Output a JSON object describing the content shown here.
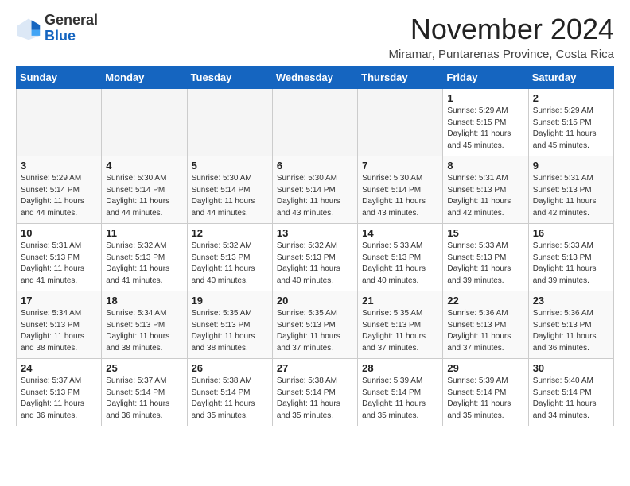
{
  "header": {
    "logo_general": "General",
    "logo_blue": "Blue",
    "month": "November 2024",
    "location": "Miramar, Puntarenas Province, Costa Rica"
  },
  "days_header": [
    "Sunday",
    "Monday",
    "Tuesday",
    "Wednesday",
    "Thursday",
    "Friday",
    "Saturday"
  ],
  "weeks": [
    [
      {
        "day": "",
        "empty": true
      },
      {
        "day": "",
        "empty": true
      },
      {
        "day": "",
        "empty": true
      },
      {
        "day": "",
        "empty": true
      },
      {
        "day": "",
        "empty": true
      },
      {
        "day": "1",
        "info": "Sunrise: 5:29 AM\nSunset: 5:15 PM\nDaylight: 11 hours\nand 45 minutes."
      },
      {
        "day": "2",
        "info": "Sunrise: 5:29 AM\nSunset: 5:15 PM\nDaylight: 11 hours\nand 45 minutes."
      }
    ],
    [
      {
        "day": "3",
        "info": "Sunrise: 5:29 AM\nSunset: 5:14 PM\nDaylight: 11 hours\nand 44 minutes."
      },
      {
        "day": "4",
        "info": "Sunrise: 5:30 AM\nSunset: 5:14 PM\nDaylight: 11 hours\nand 44 minutes."
      },
      {
        "day": "5",
        "info": "Sunrise: 5:30 AM\nSunset: 5:14 PM\nDaylight: 11 hours\nand 44 minutes."
      },
      {
        "day": "6",
        "info": "Sunrise: 5:30 AM\nSunset: 5:14 PM\nDaylight: 11 hours\nand 43 minutes."
      },
      {
        "day": "7",
        "info": "Sunrise: 5:30 AM\nSunset: 5:14 PM\nDaylight: 11 hours\nand 43 minutes."
      },
      {
        "day": "8",
        "info": "Sunrise: 5:31 AM\nSunset: 5:13 PM\nDaylight: 11 hours\nand 42 minutes."
      },
      {
        "day": "9",
        "info": "Sunrise: 5:31 AM\nSunset: 5:13 PM\nDaylight: 11 hours\nand 42 minutes."
      }
    ],
    [
      {
        "day": "10",
        "info": "Sunrise: 5:31 AM\nSunset: 5:13 PM\nDaylight: 11 hours\nand 41 minutes."
      },
      {
        "day": "11",
        "info": "Sunrise: 5:32 AM\nSunset: 5:13 PM\nDaylight: 11 hours\nand 41 minutes."
      },
      {
        "day": "12",
        "info": "Sunrise: 5:32 AM\nSunset: 5:13 PM\nDaylight: 11 hours\nand 40 minutes."
      },
      {
        "day": "13",
        "info": "Sunrise: 5:32 AM\nSunset: 5:13 PM\nDaylight: 11 hours\nand 40 minutes."
      },
      {
        "day": "14",
        "info": "Sunrise: 5:33 AM\nSunset: 5:13 PM\nDaylight: 11 hours\nand 40 minutes."
      },
      {
        "day": "15",
        "info": "Sunrise: 5:33 AM\nSunset: 5:13 PM\nDaylight: 11 hours\nand 39 minutes."
      },
      {
        "day": "16",
        "info": "Sunrise: 5:33 AM\nSunset: 5:13 PM\nDaylight: 11 hours\nand 39 minutes."
      }
    ],
    [
      {
        "day": "17",
        "info": "Sunrise: 5:34 AM\nSunset: 5:13 PM\nDaylight: 11 hours\nand 38 minutes."
      },
      {
        "day": "18",
        "info": "Sunrise: 5:34 AM\nSunset: 5:13 PM\nDaylight: 11 hours\nand 38 minutes."
      },
      {
        "day": "19",
        "info": "Sunrise: 5:35 AM\nSunset: 5:13 PM\nDaylight: 11 hours\nand 38 minutes."
      },
      {
        "day": "20",
        "info": "Sunrise: 5:35 AM\nSunset: 5:13 PM\nDaylight: 11 hours\nand 37 minutes."
      },
      {
        "day": "21",
        "info": "Sunrise: 5:35 AM\nSunset: 5:13 PM\nDaylight: 11 hours\nand 37 minutes."
      },
      {
        "day": "22",
        "info": "Sunrise: 5:36 AM\nSunset: 5:13 PM\nDaylight: 11 hours\nand 37 minutes."
      },
      {
        "day": "23",
        "info": "Sunrise: 5:36 AM\nSunset: 5:13 PM\nDaylight: 11 hours\nand 36 minutes."
      }
    ],
    [
      {
        "day": "24",
        "info": "Sunrise: 5:37 AM\nSunset: 5:13 PM\nDaylight: 11 hours\nand 36 minutes."
      },
      {
        "day": "25",
        "info": "Sunrise: 5:37 AM\nSunset: 5:14 PM\nDaylight: 11 hours\nand 36 minutes."
      },
      {
        "day": "26",
        "info": "Sunrise: 5:38 AM\nSunset: 5:14 PM\nDaylight: 11 hours\nand 35 minutes."
      },
      {
        "day": "27",
        "info": "Sunrise: 5:38 AM\nSunset: 5:14 PM\nDaylight: 11 hours\nand 35 minutes."
      },
      {
        "day": "28",
        "info": "Sunrise: 5:39 AM\nSunset: 5:14 PM\nDaylight: 11 hours\nand 35 minutes."
      },
      {
        "day": "29",
        "info": "Sunrise: 5:39 AM\nSunset: 5:14 PM\nDaylight: 11 hours\nand 35 minutes."
      },
      {
        "day": "30",
        "info": "Sunrise: 5:40 AM\nSunset: 5:14 PM\nDaylight: 11 hours\nand 34 minutes."
      }
    ]
  ]
}
